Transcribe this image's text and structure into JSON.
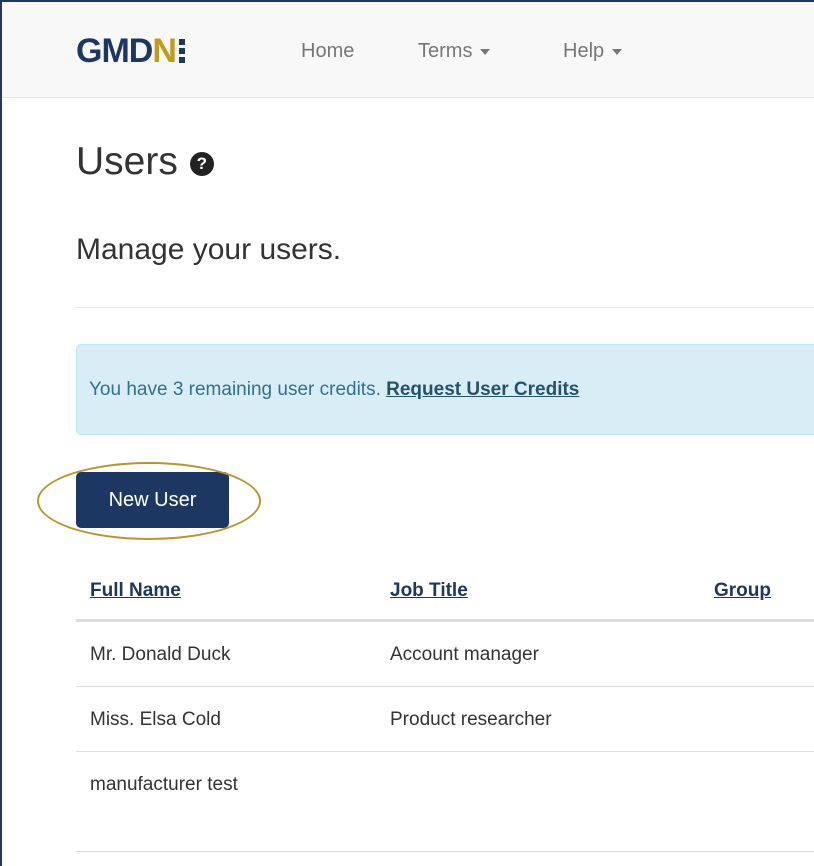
{
  "navbar": {
    "brand_text": "GMD",
    "brand_n": "N",
    "links": [
      {
        "label": "Home"
      },
      {
        "label": "Terms"
      },
      {
        "label": "Help"
      }
    ]
  },
  "page": {
    "title": "Users",
    "help_icon": "question-circle-icon",
    "help_glyph": "?",
    "subtitle": "Manage your users."
  },
  "alert": {
    "text": "You have 3 remaining user credits. ",
    "link_label": "Request User Credits"
  },
  "new_user_button": "New User",
  "table": {
    "headers": [
      "Full Name",
      "Job Title",
      "Group"
    ],
    "rows": [
      {
        "name": "Mr. Donald Duck",
        "job": "Account manager",
        "group": ""
      },
      {
        "name": "Miss. Elsa Cold",
        "job": "Product researcher",
        "group": ""
      },
      {
        "name": "manufacturer test",
        "job": "",
        "group": ""
      }
    ]
  },
  "colors": {
    "brand_navy": "#1c3862",
    "brand_gold": "#c59a1c",
    "alert_bg": "#d9edf7",
    "highlight": "#b8962e"
  }
}
